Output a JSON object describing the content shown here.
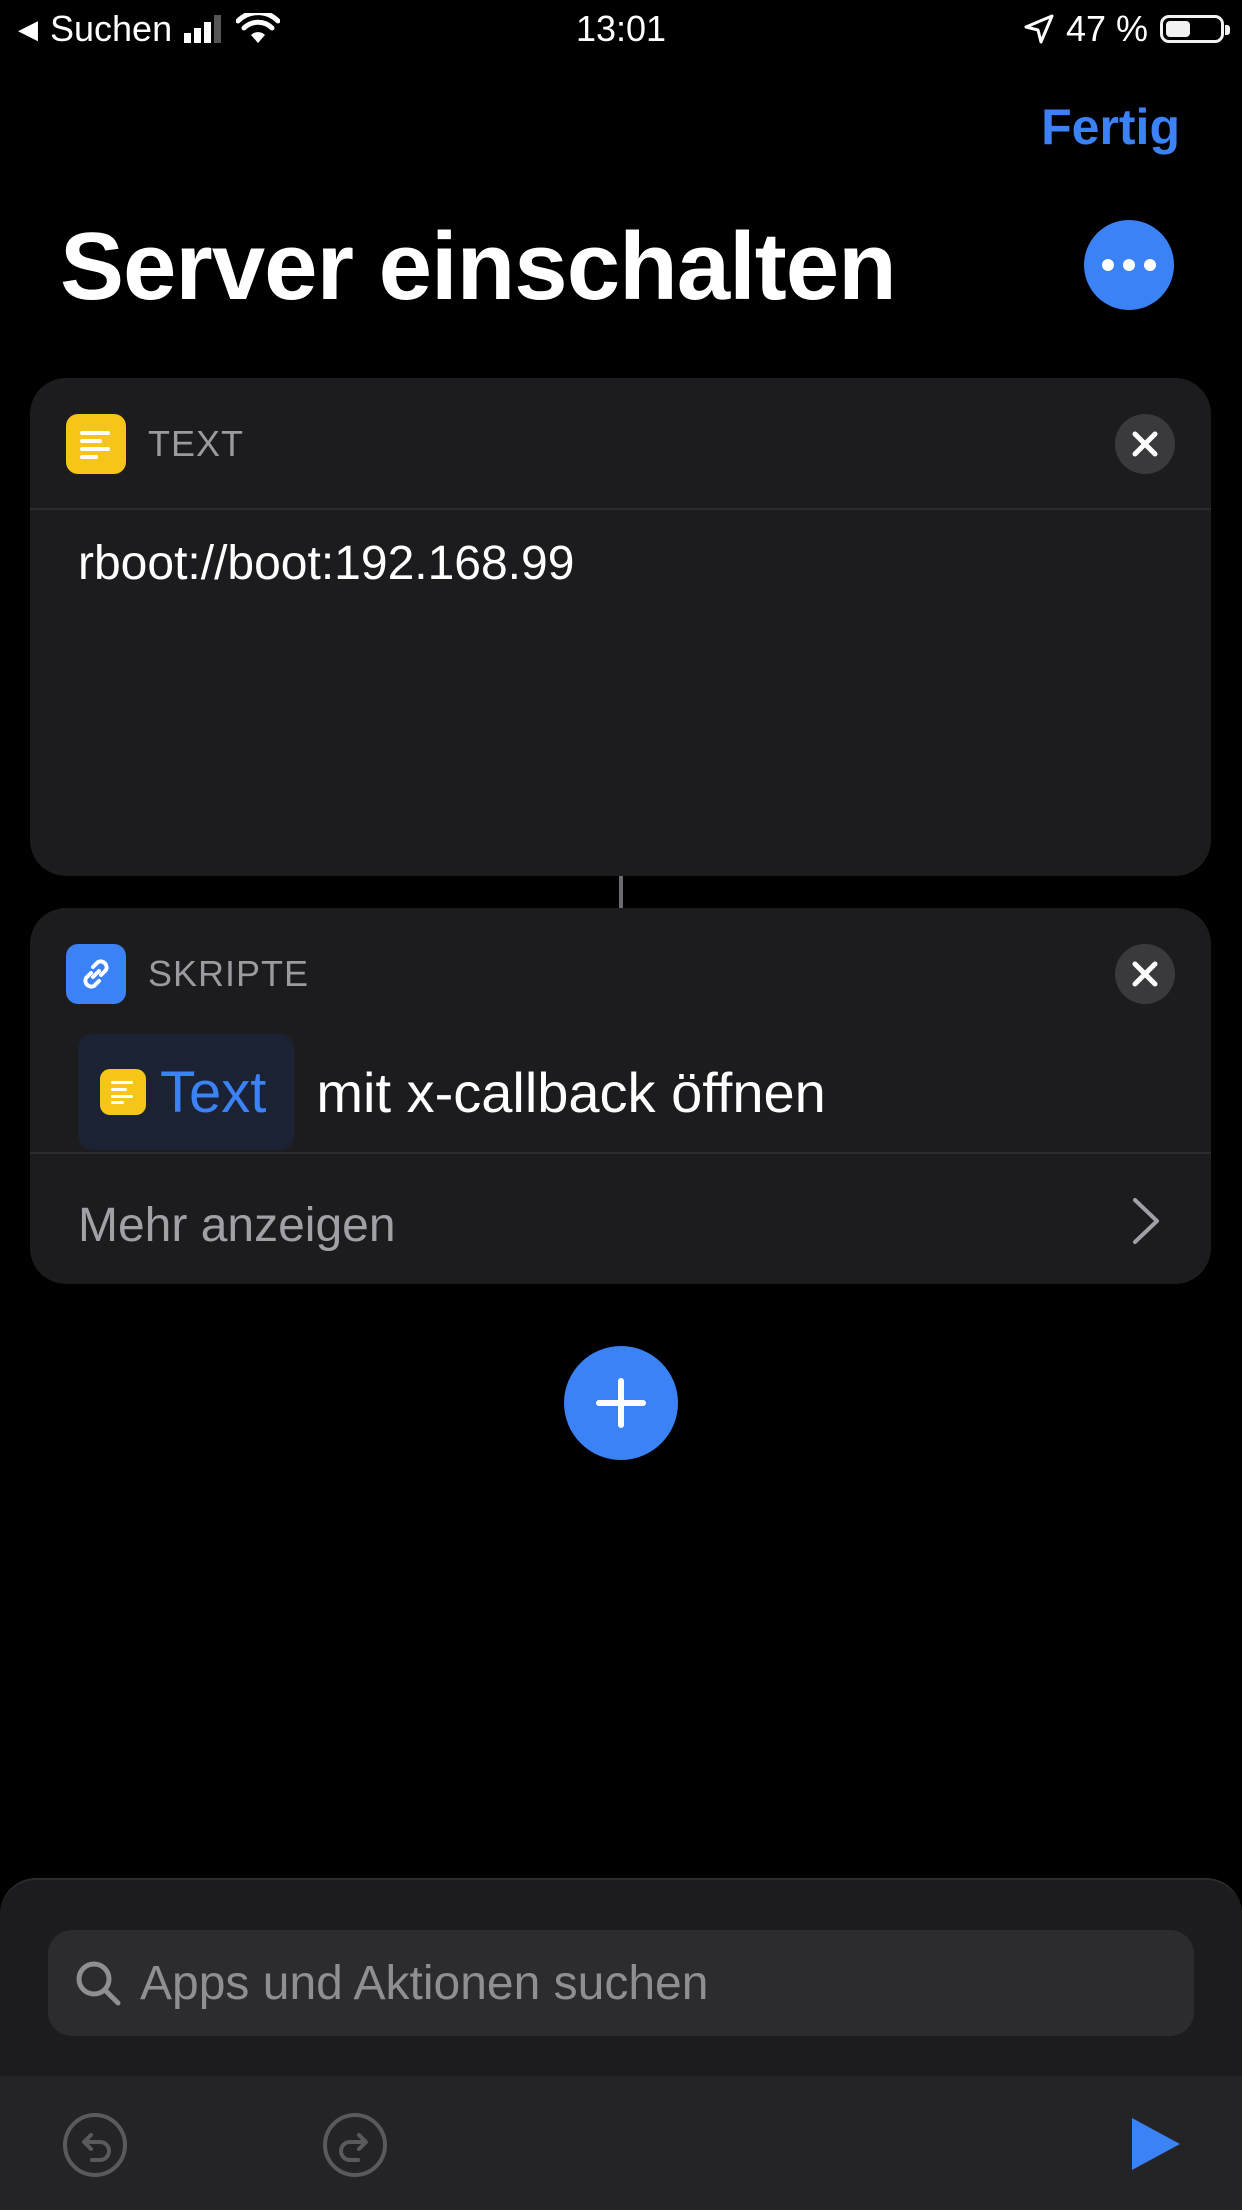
{
  "status_bar": {
    "back_label": "Suchen",
    "time": "13:01",
    "battery": "47 %",
    "battery_level": 0.47
  },
  "header": {
    "done_label": "Fertig",
    "title": "Server einschalten"
  },
  "actions": [
    {
      "icon": "text-doc-icon",
      "category": "TEXT",
      "content": "rboot://boot:192.168.99"
    },
    {
      "icon": "link-icon",
      "category": "SKRIPTE",
      "token": "Text",
      "action_text": "mit x-callback öffnen",
      "show_more": "Mehr anzeigen"
    }
  ],
  "search": {
    "placeholder": "Apps und Aktionen suchen"
  },
  "colors": {
    "accent": "#3b82f6",
    "text_icon": "#f5c518",
    "background": "#000000",
    "card": "#1c1c1e"
  }
}
